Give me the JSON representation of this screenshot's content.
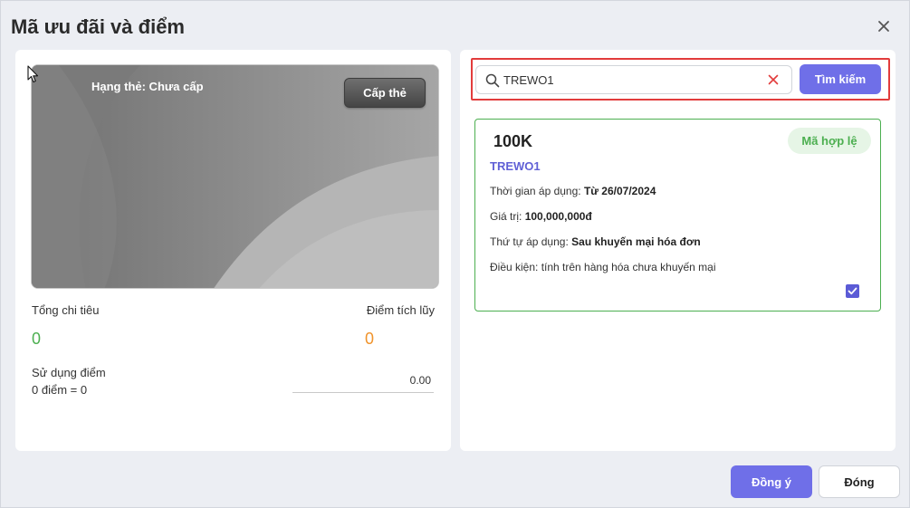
{
  "dialog": {
    "title": "Mã ưu đãi và điểm"
  },
  "member": {
    "tier_label": "Hạng thẻ: Chưa cấp",
    "tier_button": "Cấp thẻ",
    "total_spend_label": "Tổng chi tiêu",
    "total_spend_value": "0",
    "points_label": "Điểm tích lũy",
    "points_value": "0",
    "use_points_label": "Sử dụng điểm",
    "use_points_conversion": "0 điểm = 0",
    "use_points_value": "0.00"
  },
  "search": {
    "value": "TREWO1",
    "button": "Tìm kiếm"
  },
  "voucher": {
    "amount": "100K",
    "code": "TREWO1",
    "status": "Mã hợp lệ",
    "apply_time_label": "Thời gian áp dụng:",
    "apply_time_value": "Từ 26/07/2024",
    "value_label": "Giá trị:",
    "value_value": "100,000,000đ",
    "order_label": "Thứ tự áp dụng:",
    "order_value": "Sau khuyến mại hóa đơn",
    "condition": "Điều kiện: tính trên hàng hóa chưa khuyến mại",
    "selected": true
  },
  "footer": {
    "agree": "Đồng ý",
    "close": "Đóng"
  },
  "colors": {
    "accent": "#6f6fe8",
    "valid": "#4caf50",
    "points": "#f0932b",
    "highlight": "#e23c3c"
  },
  "icons": [
    "close-icon",
    "search-icon",
    "clear-icon",
    "checkmark-icon",
    "mouse-cursor-icon"
  ]
}
